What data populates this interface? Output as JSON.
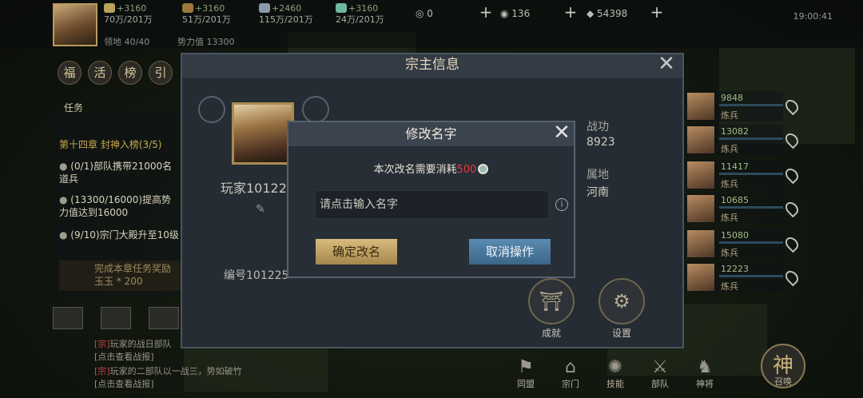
{
  "top_bar": {
    "resources": [
      {
        "name": "food",
        "main": "+3160",
        "cap": "70万/201万",
        "color": "#b9a25a"
      },
      {
        "name": "wood",
        "main": "+3160",
        "cap": "51万/201万",
        "color": "#9a7a3a"
      },
      {
        "name": "iron",
        "main": "+2460",
        "cap": "115万/201万",
        "color": "#8a9aa8"
      },
      {
        "name": "stone",
        "main": "+3160",
        "cap": "24万/201万",
        "color": "#6fb6a0"
      }
    ],
    "troops_label": "领地 40/40",
    "power_label": "势力值 13300",
    "coin_count": "0",
    "jade_count": "136",
    "gem_count": "54398",
    "clock": "19:00:41"
  },
  "left_panel": {
    "nav": [
      "福",
      "活",
      "榜",
      "引"
    ],
    "task_tab": "任务",
    "chapter": "第十四章 封神入榜(3/5)",
    "quests": [
      "(0/1)部队携带21000名道兵",
      "(13300/16000)提高势力值达到16000",
      "(9/10)宗门大殿升至10级"
    ],
    "reward_line1": "完成本章任务奖励",
    "reward_line2": "玉玉 * 200",
    "chat": [
      {
        "tag": "[宗]",
        "text": "玩家的战日部队"
      },
      {
        "tag": "",
        "text": "[点击查看战报]"
      },
      {
        "tag": "[宗]",
        "text": "玩家的二部队以一战三，势如破竹"
      },
      {
        "tag": "",
        "text": "[点击查看战报]"
      }
    ]
  },
  "heroes": [
    {
      "power": "9848",
      "status": "炼兵"
    },
    {
      "power": "13082",
      "status": "炼兵"
    },
    {
      "power": "11417",
      "status": "炼兵"
    },
    {
      "power": "10685",
      "status": "炼兵"
    },
    {
      "power": "15080",
      "status": "炼兵"
    },
    {
      "power": "12223",
      "status": "炼兵"
    }
  ],
  "bottom_nav": [
    "同盟",
    "宗门",
    "技能",
    "部队",
    "神将"
  ],
  "god_button": "神",
  "god_label": "召唤",
  "info_panel": {
    "title": "宗主信息",
    "player_name": "玩家10122",
    "player_id": "编号101225",
    "power_label": "战功",
    "power_value": "8923",
    "region_label": "属地",
    "region_value": "河南",
    "achievement_label": "成就",
    "settings_label": "设置"
  },
  "rename_dialog": {
    "title": "修改名字",
    "cost_prefix": "本次改名需要消耗",
    "cost_amount": "500",
    "input_placeholder": "请点击输入名字",
    "info": "i",
    "confirm": "确定改名",
    "cancel": "取消操作"
  }
}
